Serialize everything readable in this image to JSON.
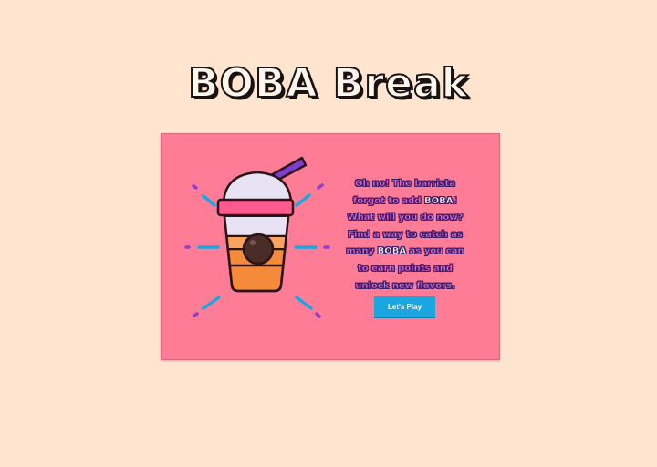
{
  "game": {
    "title": "BOBA Break",
    "message": {
      "line1": "Oh no! The barrista",
      "line2a": "forgot to add ",
      "line2b": "BOBA",
      "line2c": "!",
      "line3": "What will you do now?",
      "line4": "Find a way to catch as",
      "line5a": "many ",
      "line5b": "BOBA",
      "line5c": " as you can",
      "line6": "to earn points and",
      "line7": "unlock new flavors."
    },
    "play_label": "Let's Play"
  },
  "colors": {
    "page_bg": "#ffe4cf",
    "card_bg": "#ff7c97",
    "button": "#1ba6df",
    "text_purple": "#3b1a63",
    "ray_blue": "#1ba6df",
    "ray_purple": "#8e3fd0"
  },
  "icons": {
    "drink": "boba-cup-icon"
  }
}
